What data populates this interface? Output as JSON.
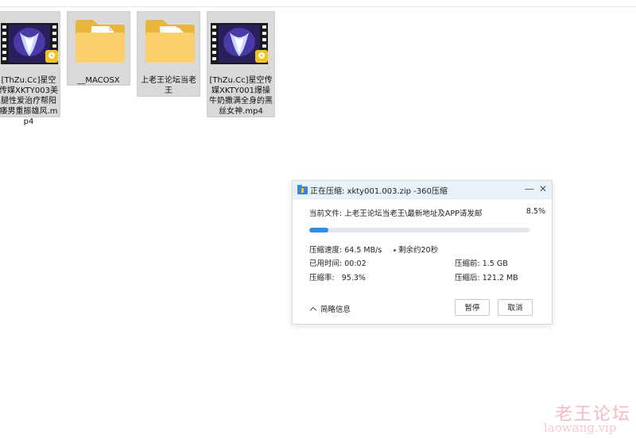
{
  "files": [
    {
      "name": "[ThZu.Cc]星空传媒XKTY003美腿性爱治疗帮阳痿男重振雄风.mp4",
      "type": "video",
      "icon": "video-file-icon",
      "badge": "Player"
    },
    {
      "name": "__MACOSX",
      "type": "folder",
      "icon": "folder-icon"
    },
    {
      "name": "上老王论坛当老王",
      "type": "folder",
      "icon": "folder-icon"
    },
    {
      "name": "[ThZu.Cc]星空传媒XKTY001爆操牛奶撒满全身的黑丝女神.mp4",
      "type": "video",
      "icon": "video-file-icon",
      "badge": "Player"
    }
  ],
  "dialog": {
    "title": "正在压缩: xkty001.003.zip -360压缩",
    "app_icon": "360zip-icon",
    "min_symbol": "—",
    "close_symbol": "✕",
    "current_file_label": "当前文件:",
    "current_file": "上老王论坛当老王\\最新地址及APP请发邮",
    "percent": "8.5%",
    "progress": 0.085,
    "speed_label": "压缩速度:",
    "speed": "64.5 MB/s",
    "remaining": "剩余约20秒",
    "elapsed_label": "已用时间:",
    "elapsed": "00:02",
    "before_label": "压缩前:",
    "before": "1.5 GB",
    "ratio_label": "压缩率:",
    "ratio": "95.3%",
    "after_label": "压缩后:",
    "after": "121.2 MB",
    "summary_label": "简略信息",
    "pause_label": "暂停",
    "cancel_label": "取消",
    "accent": "#2f8de4"
  },
  "watermark": {
    "cn": "老王论坛",
    "en": "laowang.vip"
  }
}
